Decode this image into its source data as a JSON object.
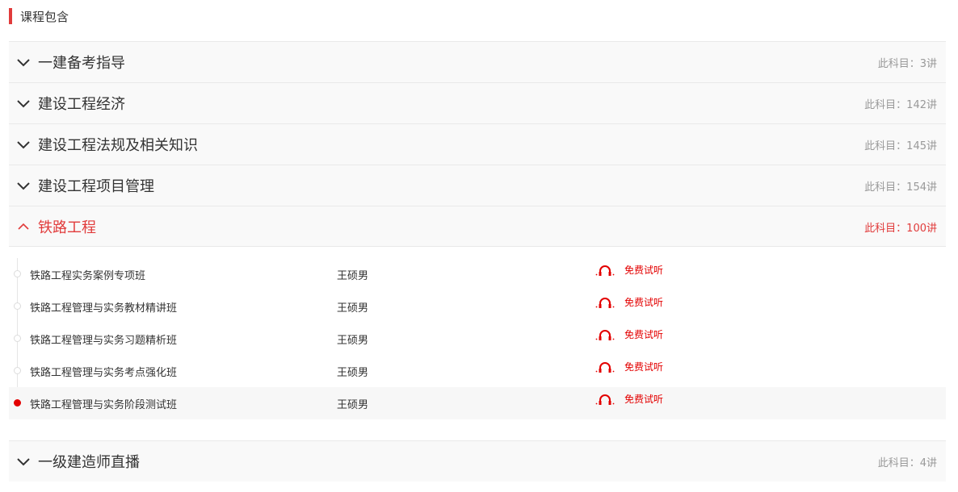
{
  "section": {
    "title": "课程包含"
  },
  "subjects_before": [
    {
      "name": "一建备考指导",
      "count": "此科目：3讲"
    },
    {
      "name": "建设工程经济",
      "count": "此科目：142讲"
    },
    {
      "name": "建设工程法规及相关知识",
      "count": "此科目：145讲"
    },
    {
      "name": "建设工程项目管理",
      "count": "此科目：154讲"
    }
  ],
  "open_subject": {
    "name": "铁路工程",
    "count": "此科目：100讲"
  },
  "lessons": [
    {
      "title": "铁路工程实务案例专项班",
      "teacher": "王硕男",
      "trial": "免费试听"
    },
    {
      "title": "铁路工程管理与实务教材精讲班",
      "teacher": "王硕男",
      "trial": "免费试听"
    },
    {
      "title": "铁路工程管理与实务习题精析班",
      "teacher": "王硕男",
      "trial": "免费试听"
    },
    {
      "title": "铁路工程管理与实务考点强化班",
      "teacher": "王硕男",
      "trial": "免费试听"
    },
    {
      "title": "铁路工程管理与实务阶段测试班",
      "teacher": "王硕男",
      "trial": "免费试听"
    }
  ],
  "subjects_after": [
    {
      "name": "一级建造师直播",
      "count": "此科目：4讲"
    }
  ],
  "colors": {
    "accent": "#e13b3b",
    "trial": "#e30000"
  },
  "icons": {
    "collapsed": "chevron-down-icon",
    "expanded": "chevron-up-icon",
    "trial": "headphones-icon"
  }
}
